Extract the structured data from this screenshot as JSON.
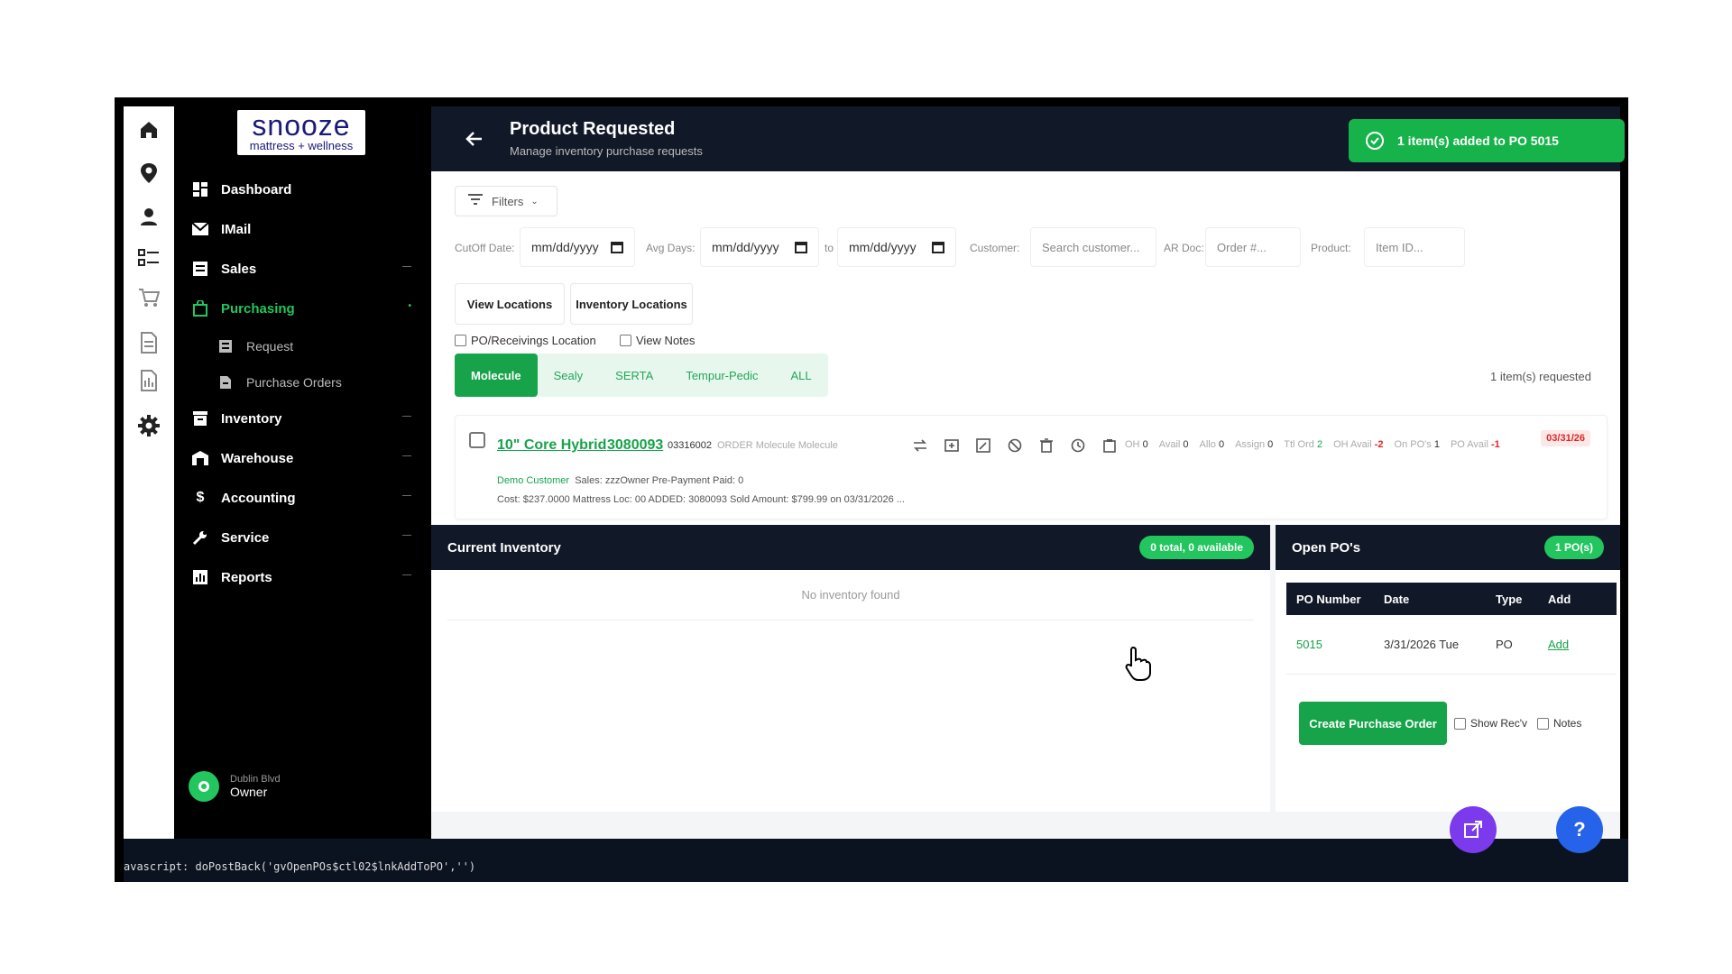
{
  "brand": {
    "logo_main": "snooze",
    "logo_sub": "mattress + wellness"
  },
  "nav": {
    "items": [
      {
        "label": "Dashboard"
      },
      {
        "label": "IMail"
      },
      {
        "label": "Sales"
      },
      {
        "label": "Purchasing"
      },
      {
        "label": "Inventory"
      },
      {
        "label": "Warehouse"
      },
      {
        "label": "Accounting"
      },
      {
        "label": "Service"
      },
      {
        "label": "Reports"
      }
    ],
    "sub": [
      {
        "label": "Request"
      },
      {
        "label": "Purchase Orders"
      }
    ]
  },
  "user": {
    "location": "Dublin Blvd",
    "role": "Owner"
  },
  "header": {
    "title": "Product Requested",
    "subtitle": "Manage inventory purchase requests"
  },
  "toast": {
    "text": "1 item(s) added to PO 5015"
  },
  "filters": {
    "button": "Filters",
    "cutoff_label": "CutOff Date:",
    "cutoff_value": "mm/dd/yyyy",
    "avg_label": "Avg Days:",
    "avg_from": "mm/dd/yyyy",
    "to_label": "to",
    "avg_to": "mm/dd/yyyy",
    "customer_label": "Customer:",
    "customer_placeholder": "Search customer...",
    "ardoc_label": "AR Doc:",
    "ardoc_placeholder": "Order #...",
    "product_label": "Product:",
    "product_placeholder": "Item ID..."
  },
  "loc_buttons": {
    "view": "View Locations",
    "inventory": "Inventory Locations"
  },
  "checks": {
    "po_recv": "PO/Receivings Location",
    "notes": "View Notes"
  },
  "tabs": [
    "Molecule",
    "Sealy",
    "SERTA",
    "Tempur-Pedic",
    "ALL"
  ],
  "requested_count": "1 item(s) requested",
  "product": {
    "name": "10\" Core Hybrid",
    "code": "3080093",
    "id": "03316002",
    "meta": "ORDER  Molecule  Molecule",
    "stats": {
      "oh_label": "OH",
      "oh": "0",
      "avail_label": "Avail",
      "avail": "0",
      "allo_label": "Allo",
      "allo": "0",
      "assign_label": "Assign",
      "assign": "0",
      "ttl_label": "Ttl Ord",
      "ttl": "2",
      "ohavail_label": "OH Avail",
      "ohavail": "-2",
      "onpo_label": "On PO's",
      "onpo": "1",
      "poavail_label": "PO Avail",
      "poavail": "-1"
    },
    "date": "03/31/26",
    "customer": "Demo Customer",
    "line2_rest": "Sales: zzzOwner  Pre-Payment  Paid: 0",
    "line3": "Cost: $237.0000  Mattress  Loc: 00  ADDED: 3080093 Sold Amount: $799.99 on 03/31/2026 ..."
  },
  "inventory": {
    "title": "Current Inventory",
    "pill": "0 total, 0 available",
    "empty": "No inventory found"
  },
  "open_pos": {
    "title": "Open PO's",
    "pill": "1 PO(s)",
    "columns": [
      "PO Number",
      "Date",
      "Type",
      "Add"
    ],
    "rows": [
      {
        "po": "5015",
        "date": "3/31/2026 Tue",
        "type": "PO",
        "add": "Add"
      }
    ],
    "create_button": "Create Purchase Order",
    "show_recv": "Show Rec'v",
    "notes": "Notes"
  },
  "status": {
    "text": "avascript: doPostBack('gvOpenPOs$ctl02$lnkAddToPO','')"
  },
  "colors": {
    "accent": "#16a34a",
    "dark": "#111827",
    "danger": "#dc2626"
  }
}
